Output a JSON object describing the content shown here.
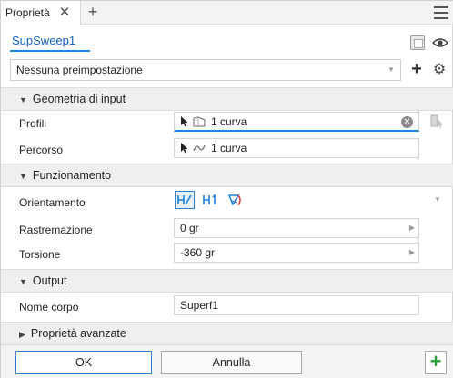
{
  "tab": {
    "title": "Proprietà",
    "close_icon": "close-icon",
    "add_icon": "plus-icon"
  },
  "header": {
    "feature_name": "SupSweep1",
    "eye_icon": "eye-icon"
  },
  "preset": {
    "value": "Nessuna preimpostazione"
  },
  "sections": {
    "input": {
      "title": "Geometria di input",
      "profili": {
        "label": "Profili",
        "value": "1 curva"
      },
      "percorso": {
        "label": "Percorso",
        "value": "1 curva"
      }
    },
    "funzionamento": {
      "title": "Funzionamento",
      "orientamento": {
        "label": "Orientamento"
      },
      "rastremazione": {
        "label": "Rastremazione",
        "value": "0 gr"
      },
      "torsione": {
        "label": "Torsione",
        "value": "-360 gr"
      }
    },
    "output": {
      "title": "Output",
      "nome_corpo": {
        "label": "Nome corpo",
        "value": "Superf1"
      }
    },
    "avanzate": {
      "title": "Proprietà avanzate"
    }
  },
  "footer": {
    "ok_label": "OK",
    "cancel_label": "Annulla"
  },
  "colors": {
    "accent": "#1e88e5",
    "add_green": "#2e9e3e"
  }
}
